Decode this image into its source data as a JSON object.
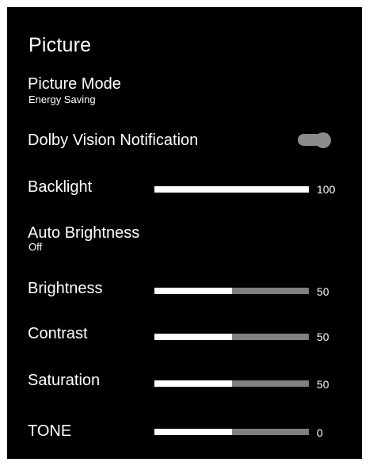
{
  "header": {
    "title": "Picture"
  },
  "picture_mode": {
    "label": "Picture Mode",
    "value": "Energy Saving"
  },
  "dolby_vision_notification": {
    "label": "Dolby Vision Notification",
    "enabled": true
  },
  "backlight": {
    "label": "Backlight",
    "value": "100",
    "level": 1.0
  },
  "auto_brightness": {
    "label": "Auto Brightness",
    "value": "Off"
  },
  "brightness": {
    "label": "Brightness",
    "value": "50",
    "level": 0.5
  },
  "contrast": {
    "label": "Contrast",
    "value": "50",
    "level": 0.5
  },
  "saturation": {
    "label": "Saturation",
    "value": "50",
    "level": 0.5
  },
  "tone": {
    "label": "TONE",
    "value": "0",
    "level": 0.5
  }
}
